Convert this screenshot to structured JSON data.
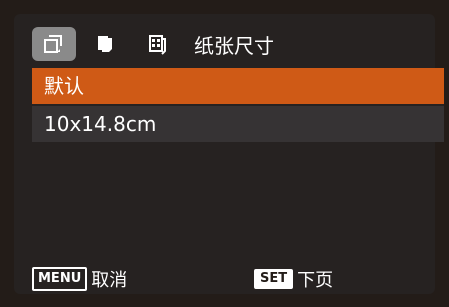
{
  "tabs": [
    {
      "icon": "pages-outline-icon"
    },
    {
      "icon": "page-filled-icon"
    },
    {
      "icon": "page-layout-icon"
    }
  ],
  "tab_title": "纸张尺寸",
  "options": [
    {
      "label": "默认",
      "selected": true
    },
    {
      "label": "10x14.8cm",
      "selected": false
    }
  ],
  "footer": {
    "menu_badge": "MENU",
    "menu_label": "取消",
    "set_badge": "SET",
    "set_label": "下页"
  },
  "colors": {
    "accent": "#cf5a16",
    "background": "#262221",
    "row": "#363334",
    "tab_active": "#8a8a8a"
  }
}
